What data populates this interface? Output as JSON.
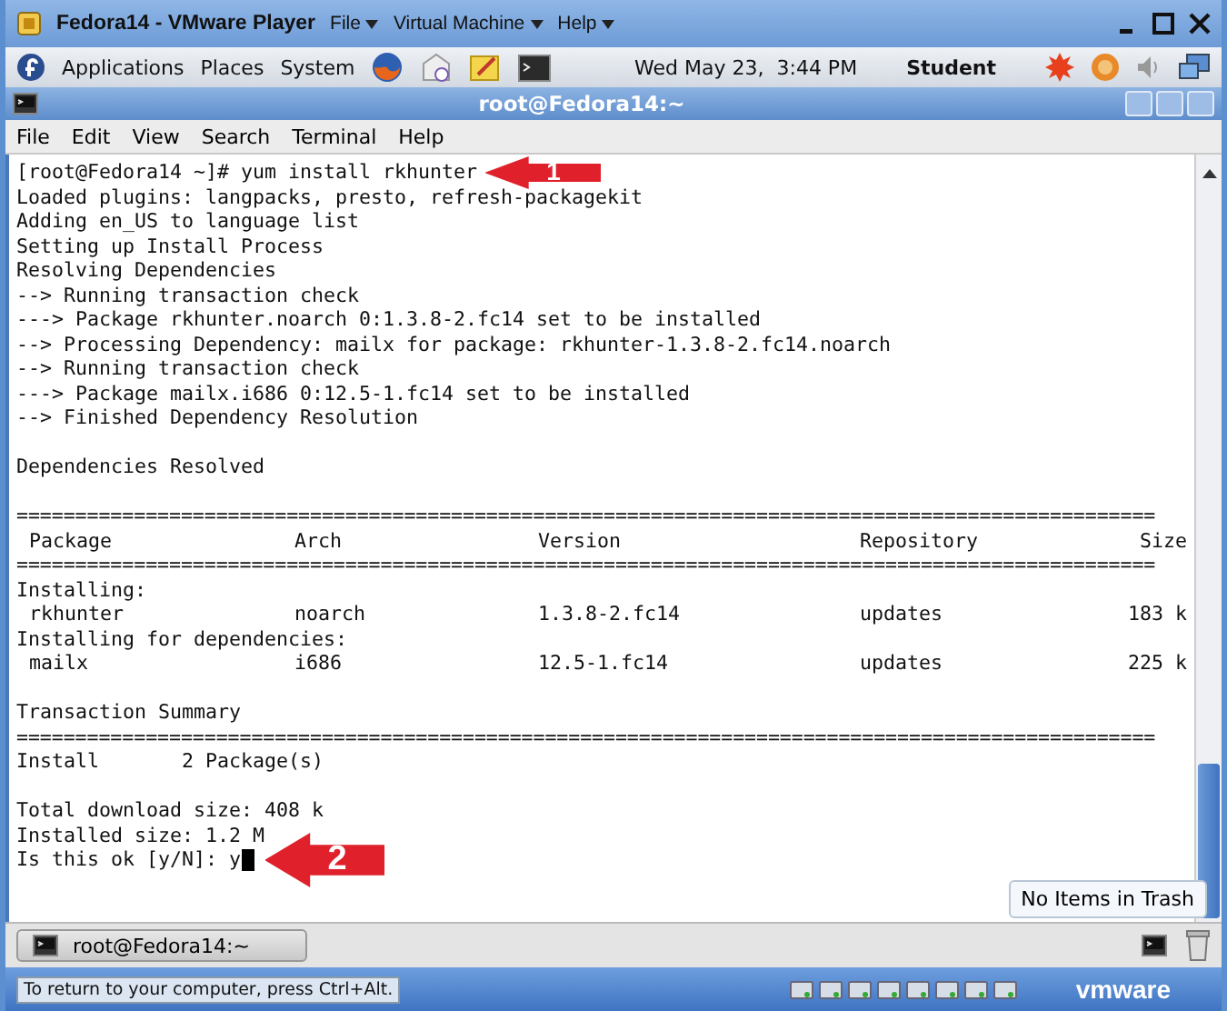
{
  "vmware": {
    "title": "Fedora14 - VMware Player",
    "menus": [
      "File",
      "Virtual Machine",
      "Help"
    ]
  },
  "top_panel": {
    "menus": [
      "Applications",
      "Places",
      "System"
    ],
    "clock": "Wed May 23,  3:44 PM",
    "user": "Student"
  },
  "terminal": {
    "title": "root@Fedora14:~",
    "menu": [
      "File",
      "Edit",
      "View",
      "Search",
      "Terminal",
      "Help"
    ],
    "lines": [
      {
        "kind": "text",
        "text": "[root@Fedora14 ~]# yum install rkhunter",
        "callout": "1"
      },
      {
        "kind": "text",
        "text": "Loaded plugins: langpacks, presto, refresh-packagekit"
      },
      {
        "kind": "text",
        "text": "Adding en_US to language list"
      },
      {
        "kind": "text",
        "text": "Setting up Install Process"
      },
      {
        "kind": "text",
        "text": "Resolving Dependencies"
      },
      {
        "kind": "text",
        "text": "--> Running transaction check"
      },
      {
        "kind": "text",
        "text": "---> Package rkhunter.noarch 0:1.3.8-2.fc14 set to be installed"
      },
      {
        "kind": "text",
        "text": "--> Processing Dependency: mailx for package: rkhunter-1.3.8-2.fc14.noarch"
      },
      {
        "kind": "text",
        "text": "--> Running transaction check"
      },
      {
        "kind": "text",
        "text": "---> Package mailx.i686 0:12.5-1.fc14 set to be installed"
      },
      {
        "kind": "text",
        "text": "--> Finished Dependency Resolution"
      },
      {
        "kind": "blank"
      },
      {
        "kind": "text",
        "text": "Dependencies Resolved"
      },
      {
        "kind": "blank"
      },
      {
        "kind": "rule",
        "text": "================================================================================================="
      },
      {
        "kind": "row",
        "cells": [
          "Package",
          "Arch",
          "Version",
          "Repository",
          "Size"
        ]
      },
      {
        "kind": "rule",
        "text": "================================================================================================="
      },
      {
        "kind": "text",
        "text": "Installing:"
      },
      {
        "kind": "row",
        "cells": [
          "rkhunter",
          "noarch",
          "1.3.8-2.fc14",
          "updates",
          "183 k"
        ]
      },
      {
        "kind": "text",
        "text": "Installing for dependencies:"
      },
      {
        "kind": "row",
        "cells": [
          "mailx",
          "i686",
          "12.5-1.fc14",
          "updates",
          "225 k"
        ]
      },
      {
        "kind": "blank"
      },
      {
        "kind": "text",
        "text": "Transaction Summary"
      },
      {
        "kind": "rule",
        "text": "================================================================================================="
      },
      {
        "kind": "text",
        "text": "Install       2 Package(s)"
      },
      {
        "kind": "blank"
      },
      {
        "kind": "text",
        "text": "Total download size: 408 k"
      },
      {
        "kind": "text",
        "text": "Installed size: 1.2 M"
      },
      {
        "kind": "text",
        "text": "Is this ok [y/N]: y",
        "cursor": true,
        "callout": "2"
      }
    ]
  },
  "bottom_panel": {
    "task": "root@Fedora14:~",
    "tooltip": "No Items in Trash"
  },
  "status_bar": {
    "hint": "To return to your computer, press Ctrl+Alt.",
    "brand": "vmware"
  }
}
